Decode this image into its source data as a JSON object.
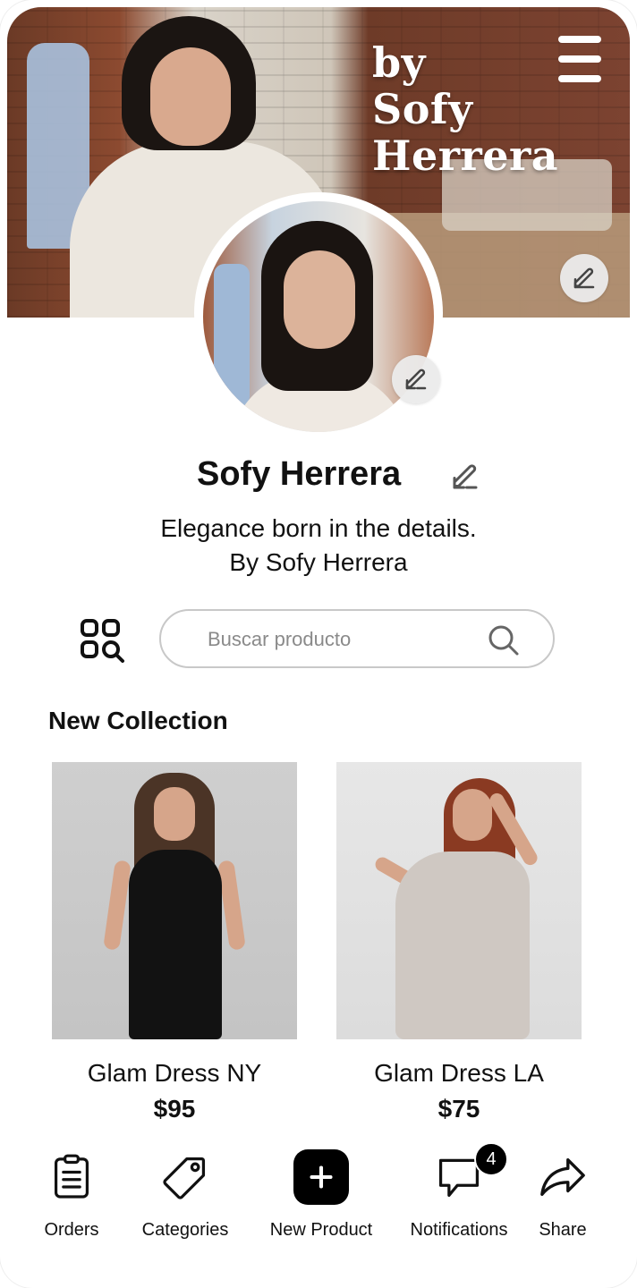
{
  "header": {
    "brand_line1": "by",
    "brand_line2": "Sofy",
    "brand_line3": "Herrera"
  },
  "profile": {
    "name": "Sofy Herrera",
    "tagline_line1": "Elegance born in the details.",
    "tagline_line2": "By Sofy Herrera"
  },
  "search": {
    "placeholder": "Buscar producto"
  },
  "collection": {
    "title": "New Collection",
    "products": [
      {
        "name": "Glam Dress NY",
        "price": "$95"
      },
      {
        "name": "Glam Dress LA",
        "price": "$75"
      }
    ]
  },
  "bottom_nav": {
    "items": [
      {
        "label": "Orders",
        "icon": "clipboard-icon"
      },
      {
        "label": "Categories",
        "icon": "tag-icon"
      },
      {
        "label": "New Product",
        "icon": "plus-icon"
      },
      {
        "label": "Notifications",
        "icon": "chat-bubble-icon"
      },
      {
        "label": "Share",
        "icon": "share-arrow-icon"
      }
    ],
    "notifications_badge": "4"
  },
  "colors": {
    "accent": "#000000",
    "text": "#111111",
    "border": "#c8c8c8",
    "edit_button_bg": "#ebebeb"
  }
}
